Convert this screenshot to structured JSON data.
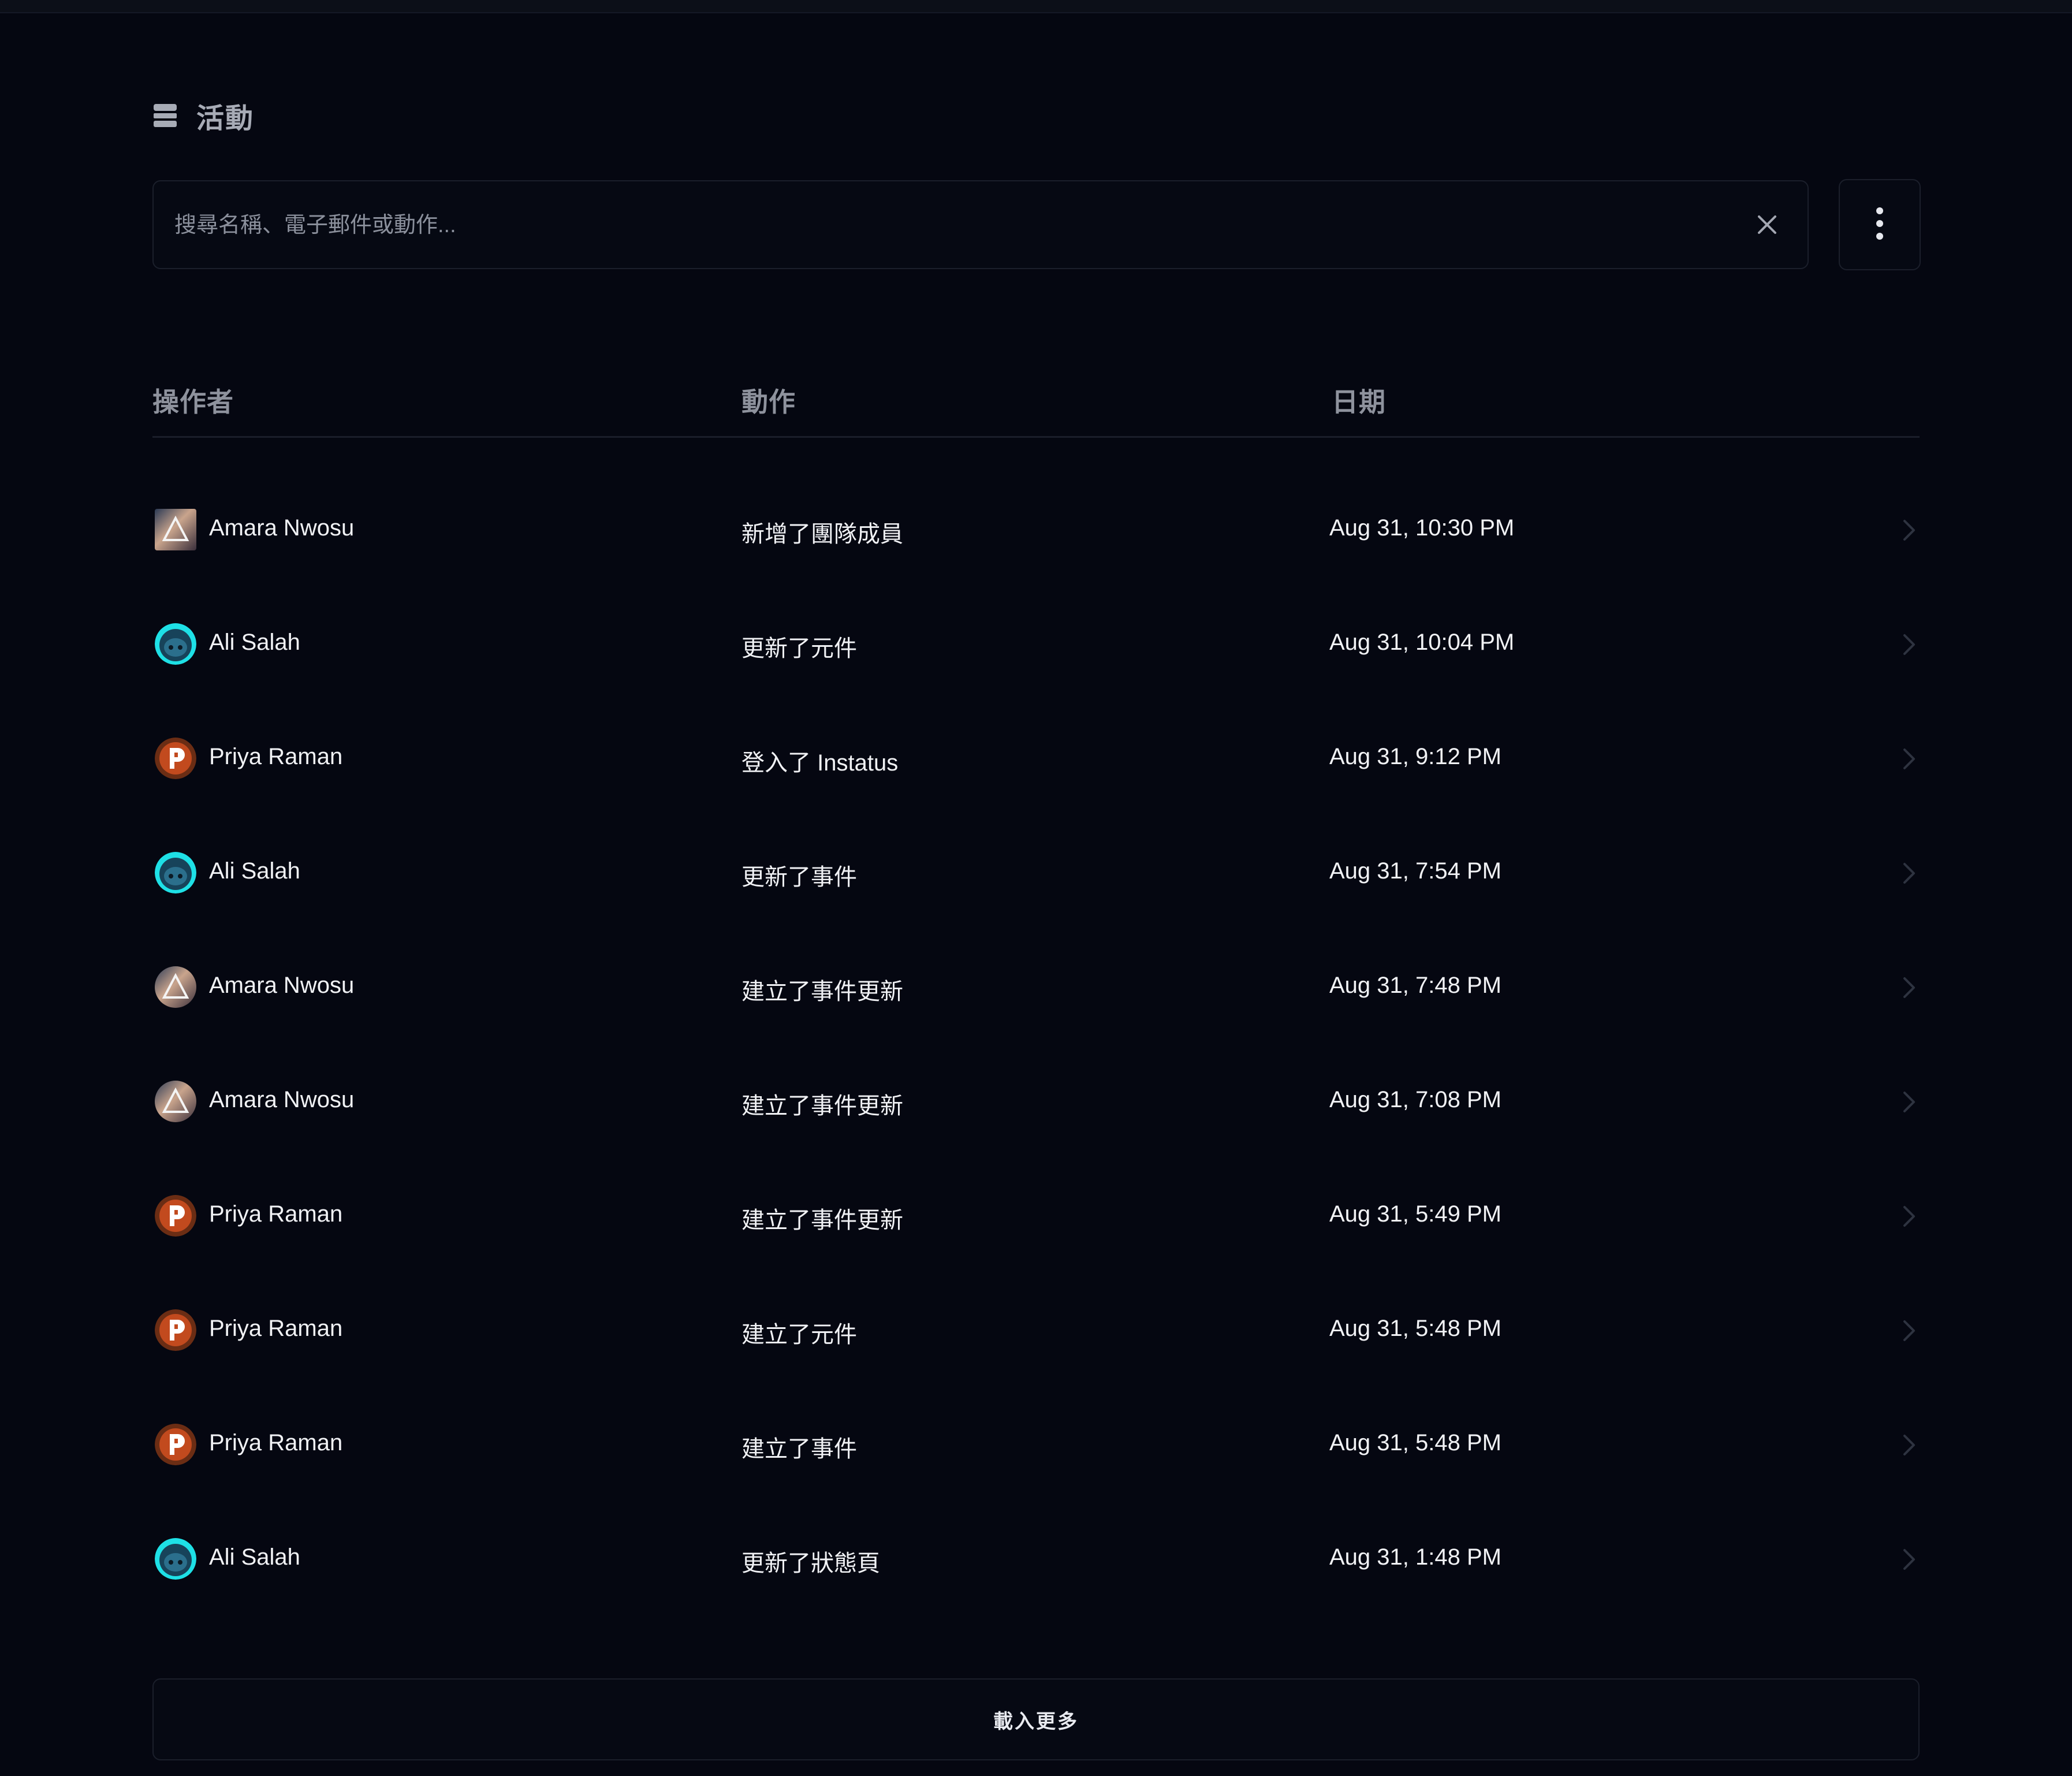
{
  "header": {
    "title": "活動",
    "icon": "database-icon"
  },
  "search": {
    "placeholder": "搜尋名稱、電子郵件或動作...",
    "value": ""
  },
  "table": {
    "columns": [
      "操作者",
      "動作",
      "日期"
    ],
    "rows": [
      {
        "actor": "Amara Nwosu",
        "avatar": "amara",
        "action": "新增了團隊成員",
        "date": "Aug 31, 10:30 PM"
      },
      {
        "actor": "Ali Salah",
        "avatar": "ali",
        "action": "更新了元件",
        "date": "Aug 31, 10:04 PM"
      },
      {
        "actor": "Priya Raman",
        "avatar": "priya",
        "action": "登入了 Instatus",
        "date": "Aug 31, 9:12 PM"
      },
      {
        "actor": "Ali Salah",
        "avatar": "ali",
        "action": "更新了事件",
        "date": "Aug 31, 7:54 PM"
      },
      {
        "actor": "Amara Nwosu",
        "avatar": "amara",
        "action": "建立了事件更新",
        "date": "Aug 31, 7:48 PM"
      },
      {
        "actor": "Amara Nwosu",
        "avatar": "amara",
        "action": "建立了事件更新",
        "date": "Aug 31, 7:08 PM"
      },
      {
        "actor": "Priya Raman",
        "avatar": "priya",
        "action": "建立了事件更新",
        "date": "Aug 31, 5:49 PM"
      },
      {
        "actor": "Priya Raman",
        "avatar": "priya",
        "action": "建立了元件",
        "date": "Aug 31, 5:48 PM"
      },
      {
        "actor": "Priya Raman",
        "avatar": "priya",
        "action": "建立了事件",
        "date": "Aug 31, 5:48 PM"
      },
      {
        "actor": "Ali Salah",
        "avatar": "ali",
        "action": "更新了狀態頁",
        "date": "Aug 31, 1:48 PM"
      }
    ]
  },
  "load_more_label": "載入更多",
  "colors": {
    "background": "#050711",
    "border": "#1b1f2b",
    "muted_text": "#8e929d",
    "text": "#f1f2f5"
  }
}
